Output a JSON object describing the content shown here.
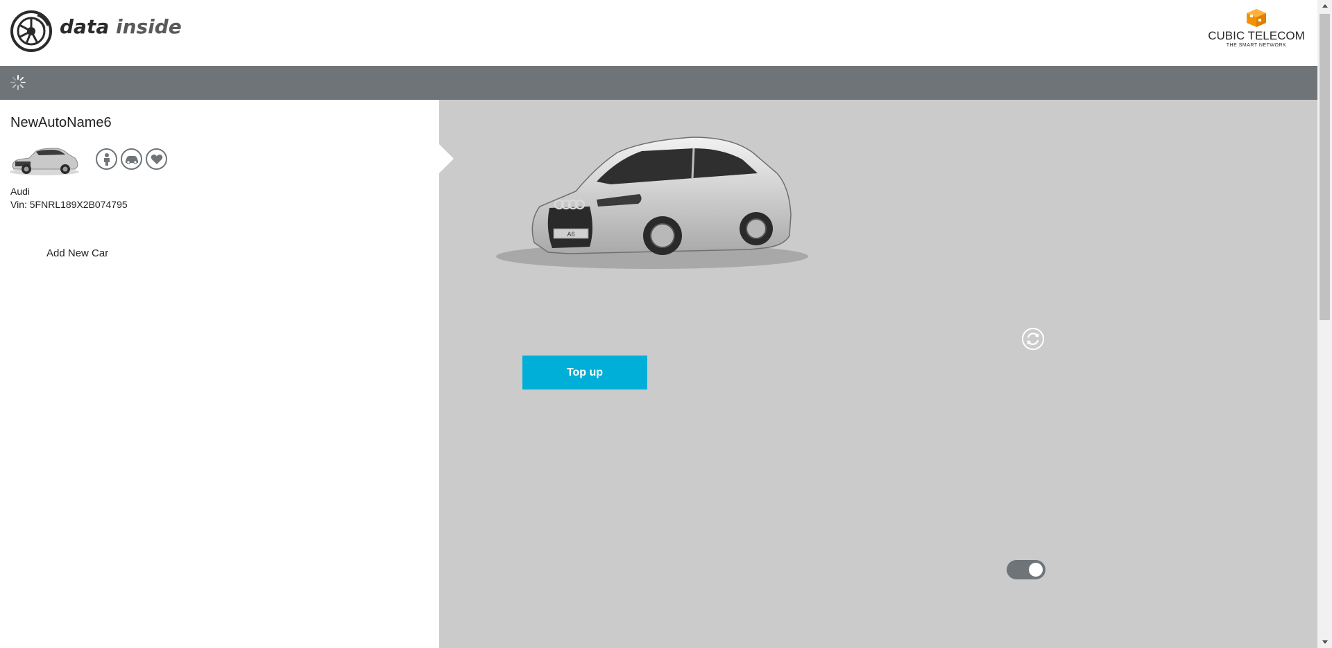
{
  "header": {
    "brand_part1": "data",
    "brand_part2": "inside",
    "partner_name": "CUBIC TELECOM",
    "partner_tagline": "THE SMART NETWORK"
  },
  "toolbar": {
    "menu_icon": "spinner-icon"
  },
  "sidebar": {
    "car_name": "NewAutoName6",
    "make": "Audi",
    "vin": "Vin: 5FNRL189X2B074795",
    "feature_icons": [
      "person-icon",
      "car-icon",
      "heart-icon"
    ],
    "add_car_label": "Add New Car"
  },
  "main": {
    "topup_label": "Top up",
    "plate_text": "A6",
    "refresh_icon": "refresh-icon",
    "toggle_on": true
  },
  "colors": {
    "toolbar": "#6f7478",
    "panel": "#cbcbcb",
    "accent": "#00afd8",
    "partner_orange": "#f39200"
  }
}
